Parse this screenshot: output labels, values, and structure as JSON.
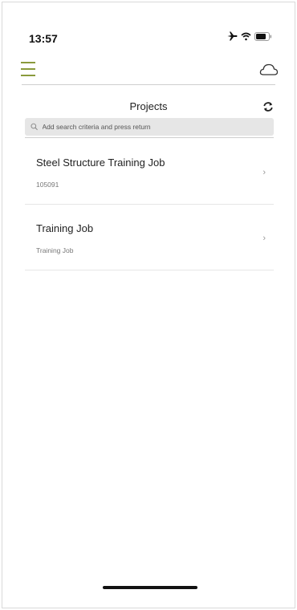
{
  "status": {
    "time": "13:57"
  },
  "header": {
    "title": "Projects"
  },
  "search": {
    "placeholder": "Add search criteria and press return",
    "value": ""
  },
  "projects": [
    {
      "name": "Steel Structure Training Job",
      "subtitle": "105091"
    },
    {
      "name": "Training Job",
      "subtitle": "Training Job"
    }
  ],
  "colors": {
    "accent": "#8a9a3c",
    "divider": "#cfcfcf",
    "search_bg": "#e6e6e6"
  },
  "icons": [
    "menu-icon",
    "cloud-icon",
    "refresh-icon",
    "search-icon",
    "chevron-right-icon",
    "airplane-icon",
    "wifi-icon",
    "battery-icon"
  ]
}
